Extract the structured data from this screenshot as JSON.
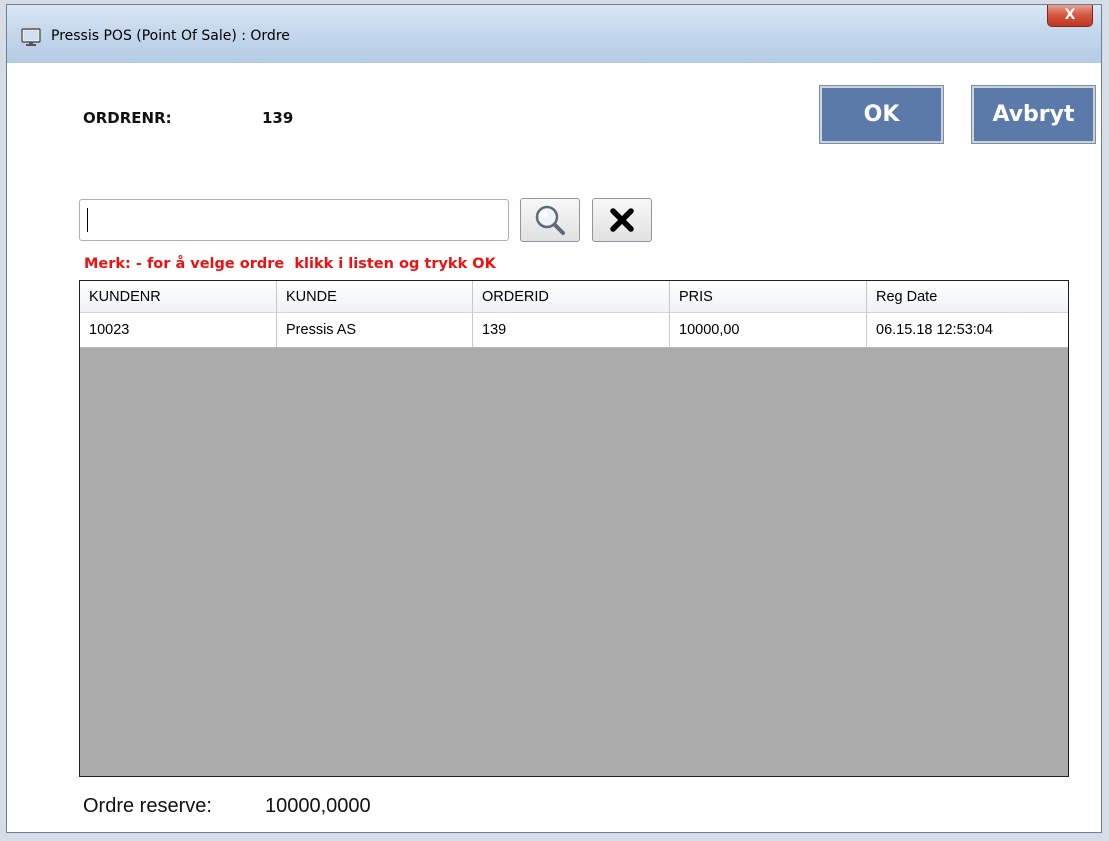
{
  "window": {
    "title": "Pressis POS (Point Of Sale) : Ordre",
    "icon": "monitor-icon",
    "close_glyph": "X"
  },
  "order": {
    "label": "ORDRENR:",
    "value": "139"
  },
  "buttons": {
    "ok_label": "OK",
    "cancel_label": "Avbryt",
    "ok_color": "#5b7aa9"
  },
  "search": {
    "value": "",
    "placeholder": "",
    "search_icon": "magnifier-icon",
    "clear_icon": "x-icon"
  },
  "note": "Merk: - for å velge ordre  klikk i listen og trykk OK",
  "note_color": "#ee1111",
  "table": {
    "columns": [
      "KUNDENR",
      "KUNDE",
      "ORDERID",
      "PRIS",
      "Reg Date"
    ],
    "rows": [
      [
        "10023",
        "Pressis AS",
        "139",
        "10000,00",
        "06.15.18 12:53:04"
      ]
    ]
  },
  "reserve": {
    "label": "Ordre reserve:",
    "value": "10000,0000"
  }
}
